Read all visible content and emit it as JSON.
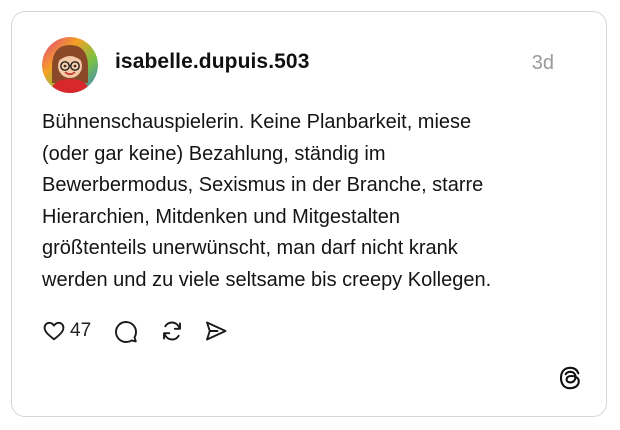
{
  "post": {
    "username": "isabelle.dupuis.503",
    "timestamp": "3d",
    "text": "Bühnenschauspielerin. Keine Planbarkeit, miese\n(oder gar keine) Bezahlung, ständig im\nBewerbermodus, Sexismus in der Branche, starre\nHierarchien, Mitdenken und Mitgestalten\ngrößtenteils unerwünscht, man darf nicht krank\nwerden und zu viele seltsame bis creepy Kollegen.",
    "like_count": "47"
  },
  "icons": {
    "like": "heart-icon",
    "comment": "comment-icon",
    "repost": "repost-icon",
    "share": "send-icon",
    "brand": "threads-logo"
  },
  "colors": {
    "border": "#d6d6d6",
    "text": "#101010",
    "muted": "#9a9a9a"
  }
}
